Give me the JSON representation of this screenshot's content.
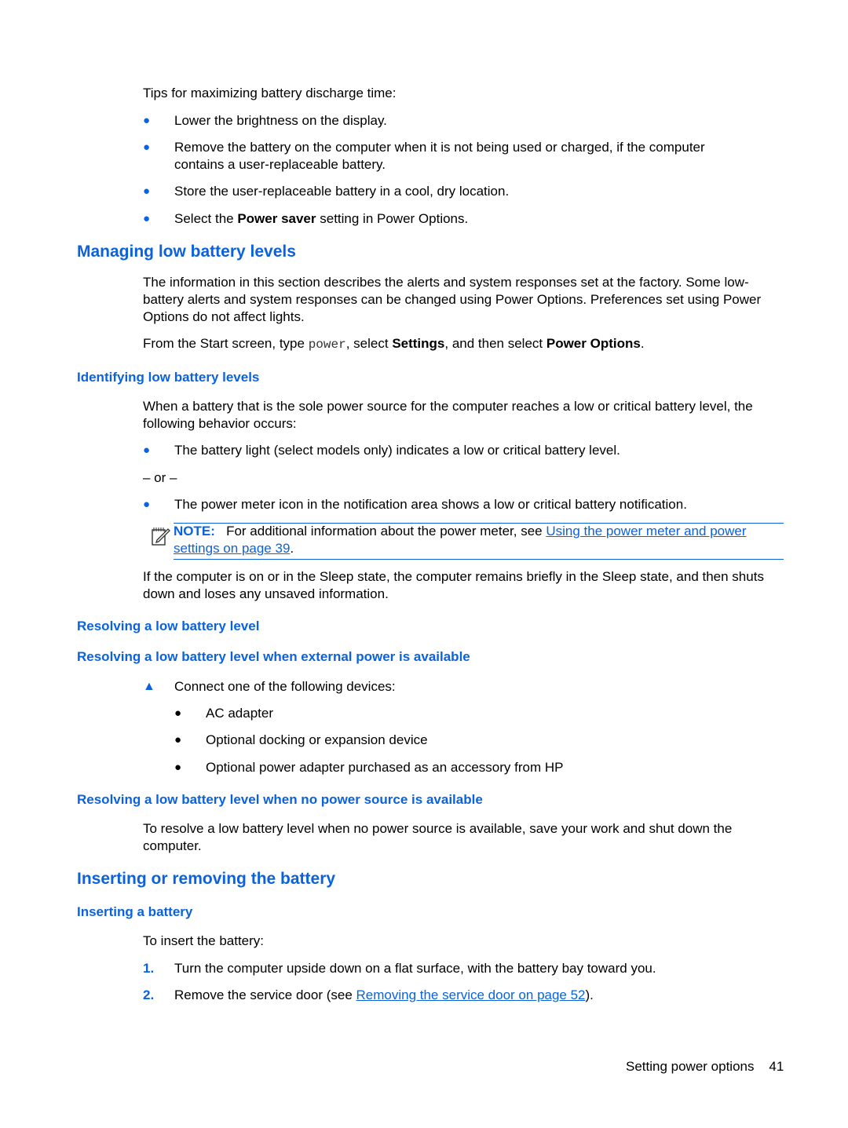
{
  "intro": {
    "lead": "Tips for maximizing battery discharge time:",
    "tips": [
      {
        "text": "Lower the brightness on the display."
      },
      {
        "text": "Remove the battery on the computer when it is not being used or charged, if the computer contains a user-replaceable battery."
      },
      {
        "text": "Store the user-replaceable battery in a cool, dry location."
      },
      {
        "pre": "Select the ",
        "bold": "Power saver",
        "post": " setting in Power Options."
      }
    ]
  },
  "managing": {
    "heading": "Managing low battery levels",
    "paragraph": "The information in this section describes the alerts and system responses set at the factory. Some low-battery alerts and system responses can be changed using Power Options. Preferences set using Power Options do not affect lights.",
    "instruction": {
      "t1": "From the Start screen, type ",
      "code": "power",
      "t2": ", select ",
      "b1": "Settings",
      "t3": ", and then select ",
      "b2": "Power Options",
      "t4": "."
    }
  },
  "identifying": {
    "heading": "Identifying low battery levels",
    "paragraph": "When a battery that is the sole power source for the computer reaches a low or critical battery level, the following behavior occurs:",
    "bullet1": "The battery light (select models only) indicates a low or critical battery level.",
    "or": "– or –",
    "bullet2": "The power meter icon in the notification area shows a low or critical battery notification.",
    "note": {
      "label": "NOTE:",
      "text": "For additional information about the power meter, see ",
      "link": "Using the power meter and power settings on page 39",
      "after": "."
    },
    "after_note": "If the computer is on or in the Sleep state, the computer remains briefly in the Sleep state, and then shuts down and loses any unsaved information."
  },
  "resolving": {
    "heading": "Resolving a low battery level",
    "external": {
      "heading": "Resolving a low battery level when external power is available",
      "step": "Connect one of the following devices:",
      "devices": [
        "AC adapter",
        "Optional docking or expansion device",
        "Optional power adapter purchased as an accessory from HP"
      ]
    },
    "none": {
      "heading": "Resolving a low battery level when no power source is available",
      "paragraph": "To resolve a low battery level when no power source is available, save your work and shut down the computer."
    }
  },
  "inserting": {
    "heading": "Inserting or removing the battery",
    "subheading": "Inserting a battery",
    "lead": "To insert the battery:",
    "steps": [
      {
        "num": "1.",
        "text": "Turn the computer upside down on a flat surface, with the battery bay toward you."
      },
      {
        "num": "2.",
        "pre": "Remove the service door (see ",
        "link": "Removing the service door on page 52",
        "post": ")."
      }
    ]
  },
  "footer": {
    "section": "Setting power options",
    "page": "41"
  },
  "colors": {
    "accent": "#0a62dd",
    "text": "#000000"
  }
}
